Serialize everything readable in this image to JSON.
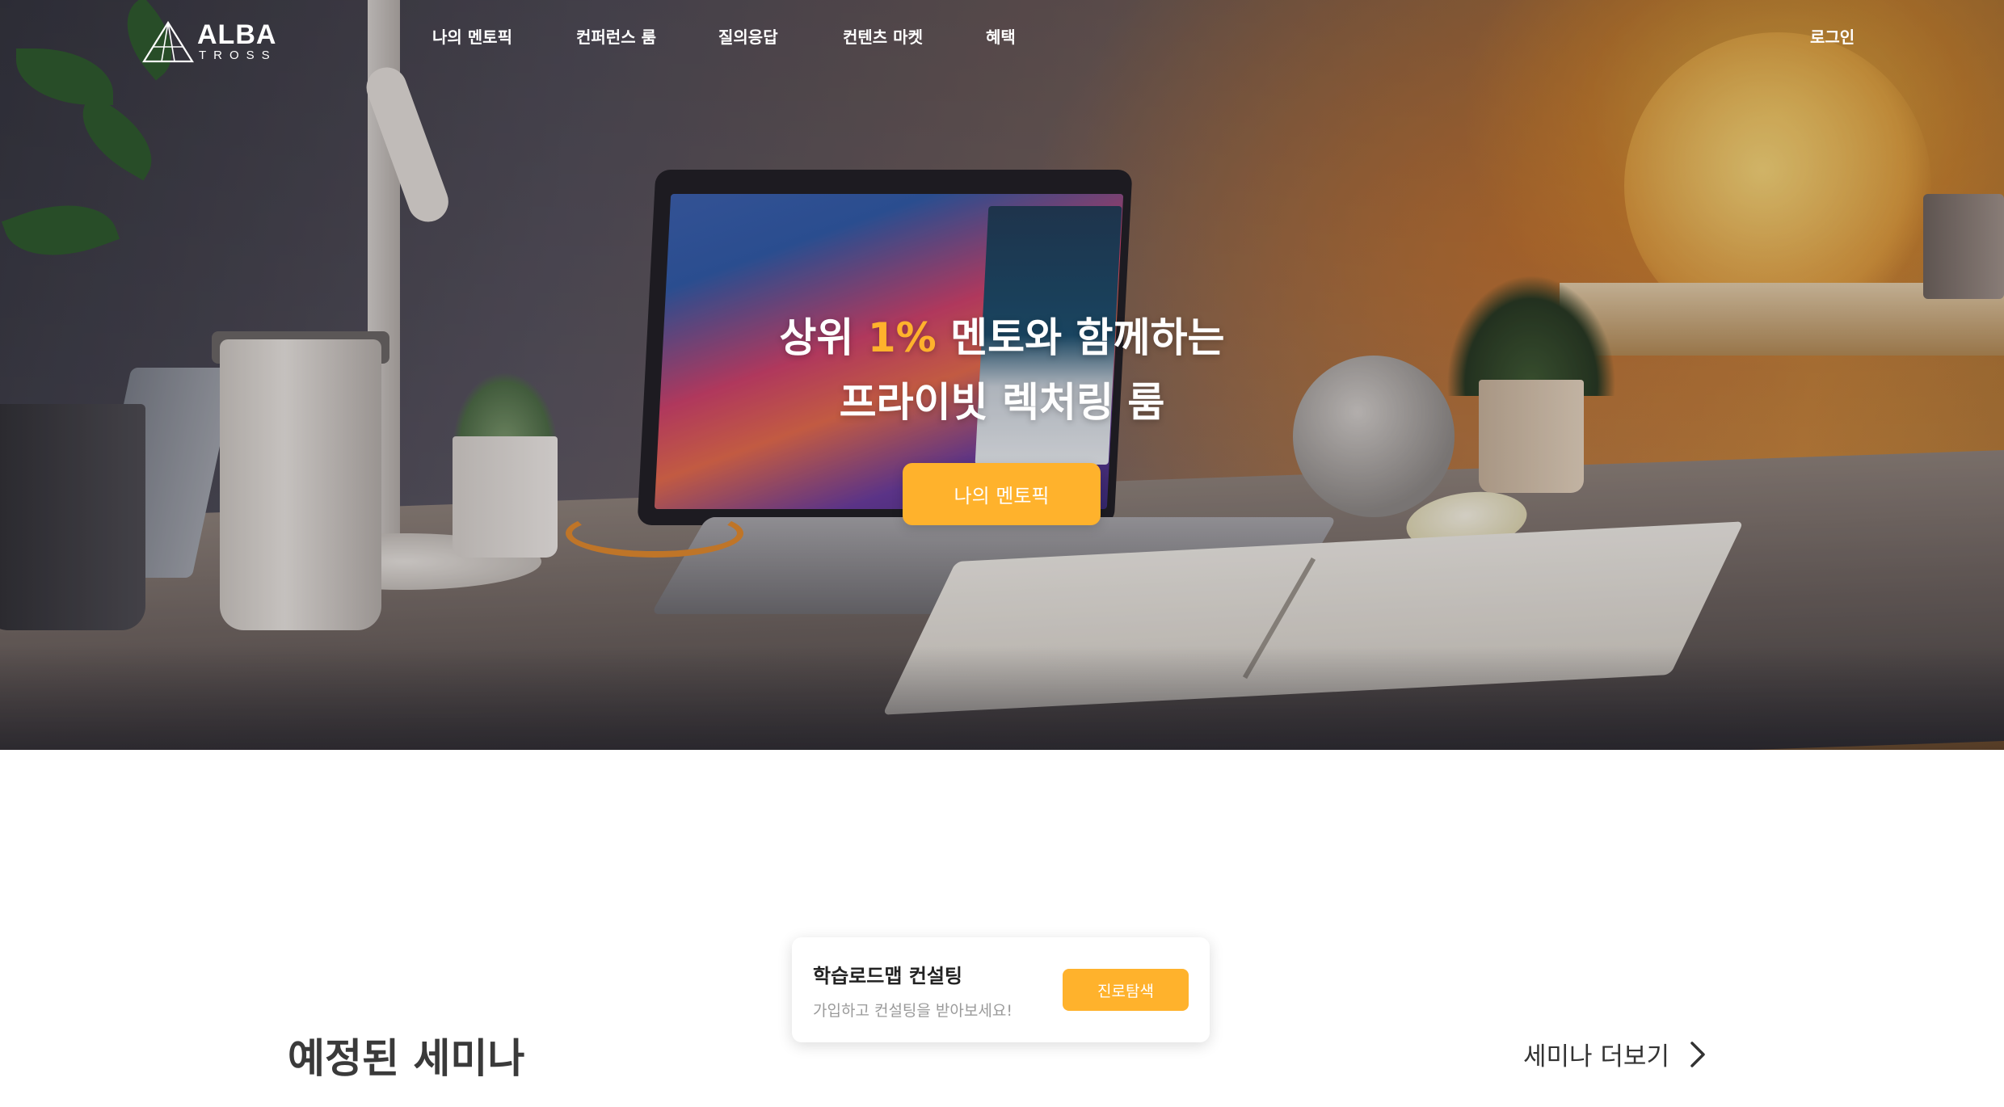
{
  "brand": {
    "name_top": "ALBA",
    "name_bottom": "TROSS",
    "accent_color": "#ffb22c"
  },
  "nav": {
    "items": [
      {
        "label": "나의 멘토픽"
      },
      {
        "label": "컨퍼런스 룸"
      },
      {
        "label": "질의응답"
      },
      {
        "label": "컨텐츠 마켓"
      },
      {
        "label": "혜택"
      }
    ],
    "login_label": "로그인"
  },
  "hero": {
    "title_line1_prefix": "상위 ",
    "title_line1_highlight": "1%",
    "title_line1_suffix": " 멘토와 함께하는",
    "title_line2": "프라이빗 렉처링 룸",
    "cta_label": "나의 멘토픽"
  },
  "consult_card": {
    "title": "학습로드맵 컨설팅",
    "subtitle": "가입하고 컨설팅을 받아보세요!",
    "button_label": "진로탐색"
  },
  "seminar": {
    "section_title": "예정된 세미나",
    "more_label": "세미나 더보기"
  },
  "icons": {
    "logo": "triangle-logo-icon",
    "more": "chevron-right-icon"
  }
}
